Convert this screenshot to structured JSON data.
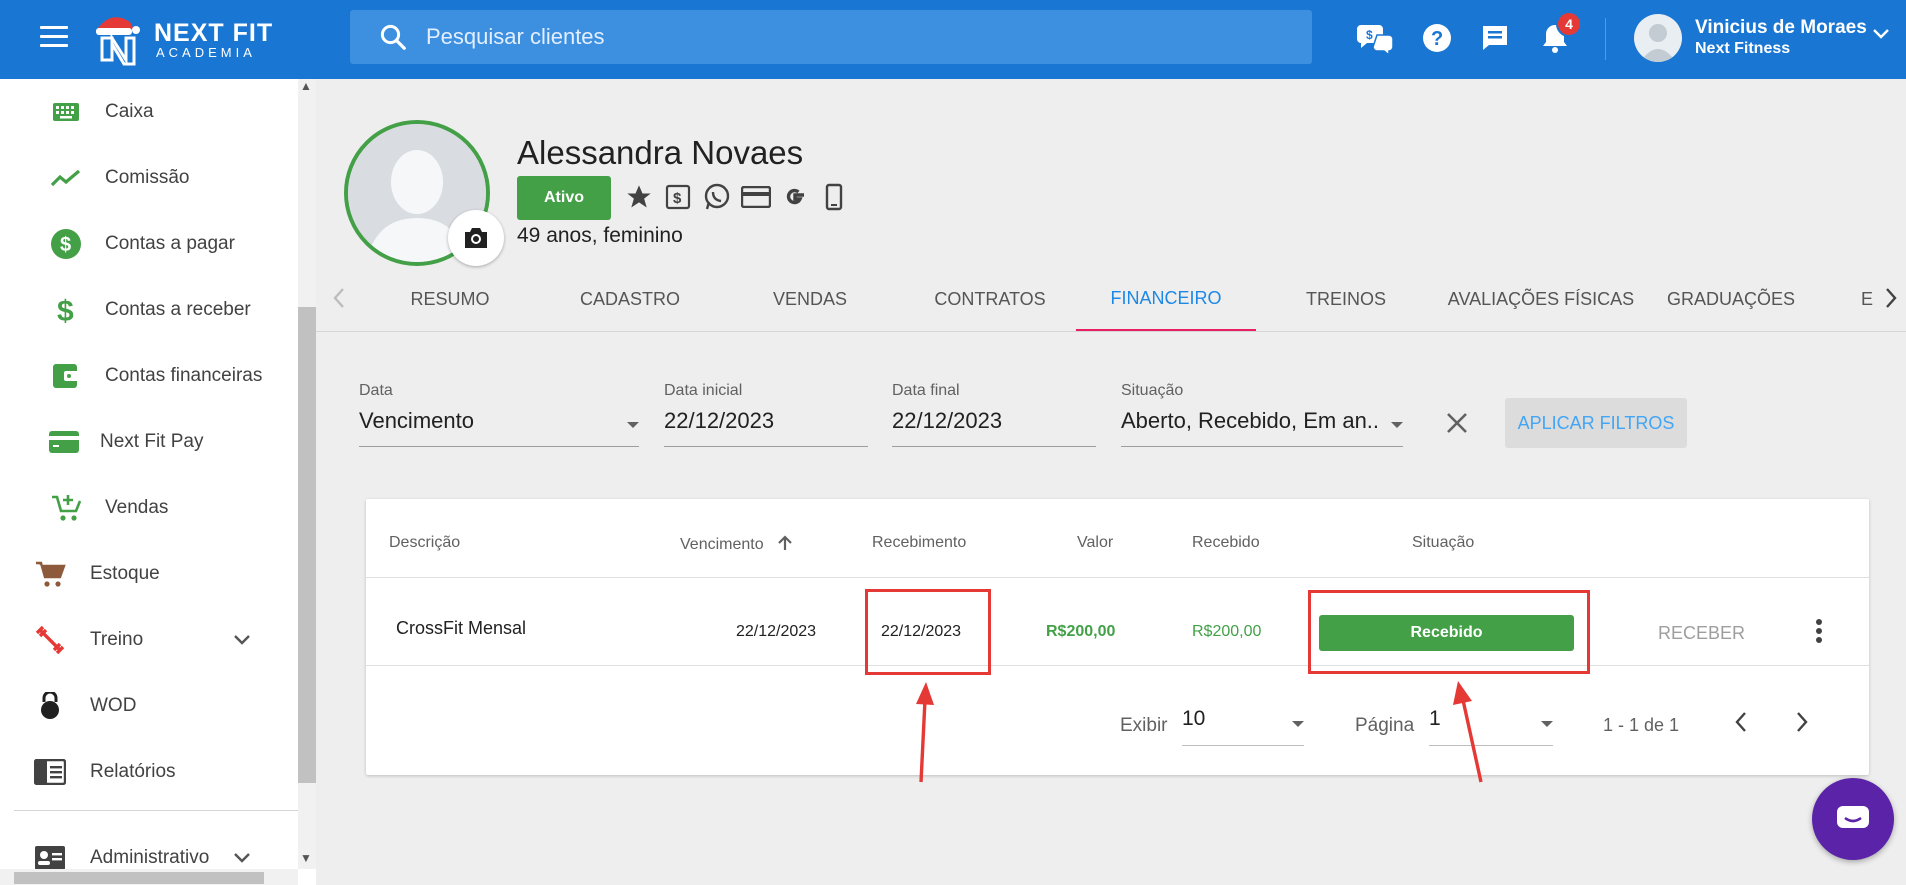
{
  "app": {
    "logo_title": "NEXT FIT",
    "logo_subtitle": "ACADEMIA"
  },
  "topbar": {
    "search_placeholder": "Pesquisar clientes",
    "notifications_count": "4",
    "user_name": "Vinicius de Moraes",
    "user_org": "Next Fitness",
    "icons": [
      "money-chat-icon",
      "help-icon",
      "chat-icon",
      "bell-icon"
    ]
  },
  "sidebar": {
    "items": [
      {
        "label": "Caixa",
        "icon": "keyboard-icon"
      },
      {
        "label": "Comissão",
        "icon": "trending-icon"
      },
      {
        "label": "Contas a pagar",
        "icon": "dollar-circle-icon"
      },
      {
        "label": "Contas a receber",
        "icon": "dollar-icon"
      },
      {
        "label": "Contas financeiras",
        "icon": "wallet-icon"
      },
      {
        "label": "Next Fit Pay",
        "icon": "card-icon"
      },
      {
        "label": "Vendas",
        "icon": "cart-plus-icon"
      },
      {
        "label": "Estoque",
        "icon": "cart-icon"
      },
      {
        "label": "Treino",
        "icon": "dumbbell-icon"
      },
      {
        "label": "WOD",
        "icon": "kettlebell-icon"
      },
      {
        "label": "Relatórios",
        "icon": "report-icon"
      },
      {
        "label": "Administrativo",
        "icon": "id-card-icon"
      }
    ]
  },
  "client": {
    "name": "Alessandra Novaes",
    "status": "Ativo",
    "info": "49 anos, feminino"
  },
  "tabs": [
    "RESUMO",
    "CADASTRO",
    "VENDAS",
    "CONTRATOS",
    "FINANCEIRO",
    "TREINOS",
    "AVALIAÇÕES FÍSICAS",
    "GRADUAÇÕES",
    "E"
  ],
  "active_tab": "FINANCEIRO",
  "filters": {
    "data_label": "Data",
    "data_value": "Vencimento",
    "inicial_label": "Data inicial",
    "inicial_value": "22/12/2023",
    "final_label": "Data final",
    "final_value": "22/12/2023",
    "situacao_label": "Situação",
    "situacao_value": "Aberto, Recebido, Em an...",
    "apply_label": "APLICAR FILTROS"
  },
  "table": {
    "headers": [
      "Descrição",
      "Vencimento",
      "Recebimento",
      "Valor",
      "Recebido",
      "Situação"
    ],
    "rows": [
      {
        "descricao": "CrossFit Mensal",
        "vencimento": "22/12/2023",
        "recebimento": "22/12/2023",
        "valor": "R$200,00",
        "recebido": "R$200,00",
        "situacao": "Recebido",
        "action": "RECEBER"
      }
    ]
  },
  "pagination": {
    "exibir_label": "Exibir",
    "exibir_value": "10",
    "pagina_label": "Página",
    "pagina_value": "1",
    "range": "1 - 1 de 1"
  },
  "colors": {
    "primary": "#1976d2",
    "success": "#43a047",
    "accent": "#e91e63",
    "highlight": "#e53935",
    "chat_fab": "#5b24a8"
  }
}
